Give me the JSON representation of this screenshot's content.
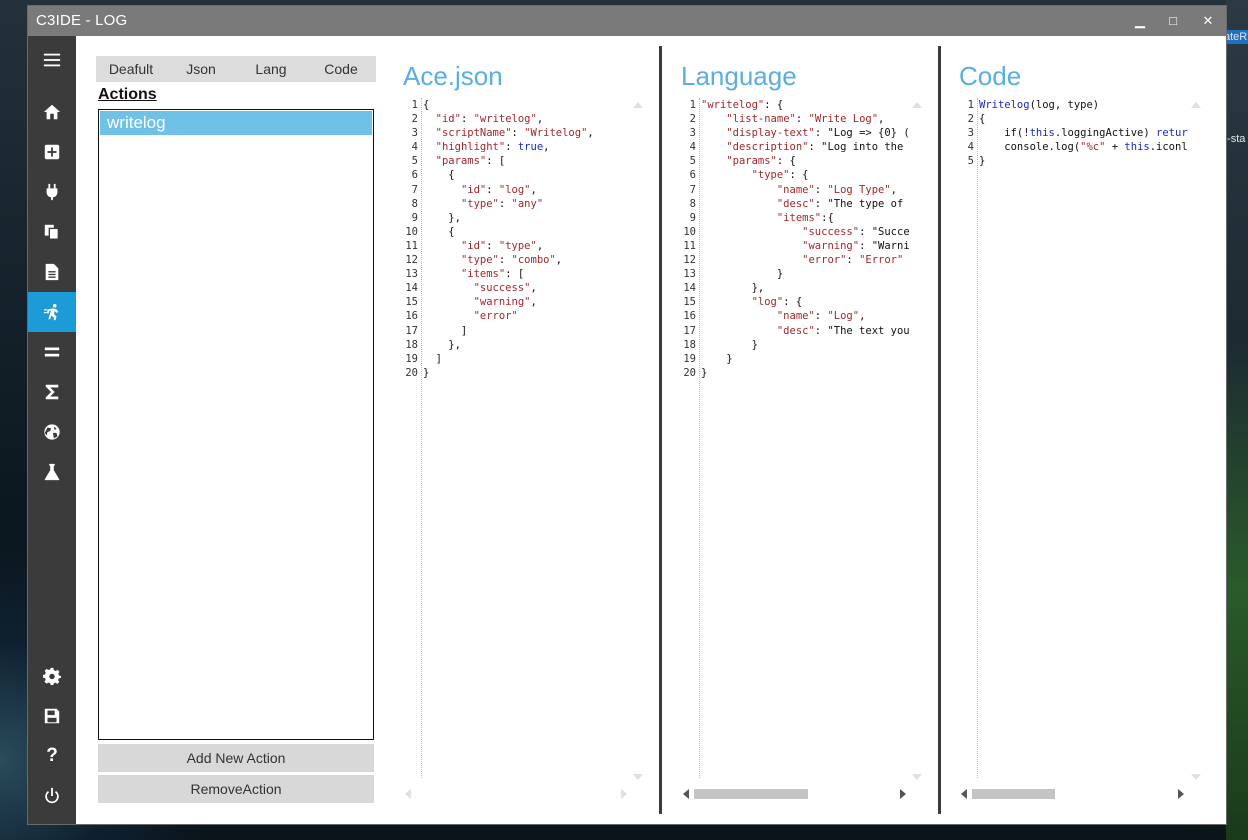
{
  "window": {
    "title": "C3IDE - LOG",
    "min": "▁",
    "max": "□",
    "close": "✕"
  },
  "desktop": {
    "text_top": "ateR",
    "text_mid": "t-sta"
  },
  "sidebar": {
    "items": [
      {
        "name": "menu-icon",
        "glyph": "☰"
      },
      {
        "name": "home-icon"
      },
      {
        "name": "add-icon"
      },
      {
        "name": "plugin-icon"
      },
      {
        "name": "copy-icon"
      },
      {
        "name": "document-icon"
      },
      {
        "name": "action-icon",
        "active": true
      },
      {
        "name": "equals-icon"
      },
      {
        "name": "sigma-icon"
      },
      {
        "name": "globe-icon"
      },
      {
        "name": "flask-icon"
      },
      {
        "name": "settings-icon"
      },
      {
        "name": "save-icon"
      },
      {
        "name": "help-icon"
      },
      {
        "name": "power-icon"
      }
    ]
  },
  "tabs": [
    "Deafult",
    "Json",
    "Lang",
    "Code"
  ],
  "actions": {
    "heading": "Actions",
    "items": [
      "writelog"
    ]
  },
  "buttons": {
    "add": "Add New Action",
    "remove": "RemoveAction"
  },
  "panes": {
    "ace": {
      "title": "Ace.json",
      "lines": [
        "{",
        "  \"id\": \"writelog\",",
        "  \"scriptName\": \"Writelog\",",
        "  \"highlight\": true,",
        "  \"params\": [",
        "    {",
        "      \"id\": \"log\",",
        "      \"type\": \"any\"",
        "    },",
        "    {",
        "      \"id\": \"type\",",
        "      \"type\": \"combo\",",
        "      \"items\": [",
        "        \"success\",",
        "        \"warning\",",
        "        \"error\"",
        "      ]",
        "    },",
        "  ]",
        "}"
      ]
    },
    "lang": {
      "title": "Language",
      "lines": [
        "\"writelog\": {",
        "    \"list-name\": \"Write Log\",",
        "    \"display-text\": \"Log => {0} (",
        "    \"description\": \"Log into the",
        "    \"params\": {",
        "        \"type\": {",
        "            \"name\": \"Log Type\",",
        "            \"desc\": \"The type of",
        "            \"items\":{",
        "                \"success\": \"Succe",
        "                \"warning\": \"Warni",
        "                \"error\": \"Error\"",
        "            }",
        "        },",
        "        \"log\": {",
        "            \"name\": \"Log\",",
        "            \"desc\": \"The text you",
        "        }",
        "    }",
        "}"
      ]
    },
    "code": {
      "title": "Code",
      "lines": [
        "Writelog(log, type)",
        "{",
        "    if(!this.loggingActive) retur",
        "    console.log(\"%c\" + this.iconl",
        "}"
      ]
    }
  }
}
